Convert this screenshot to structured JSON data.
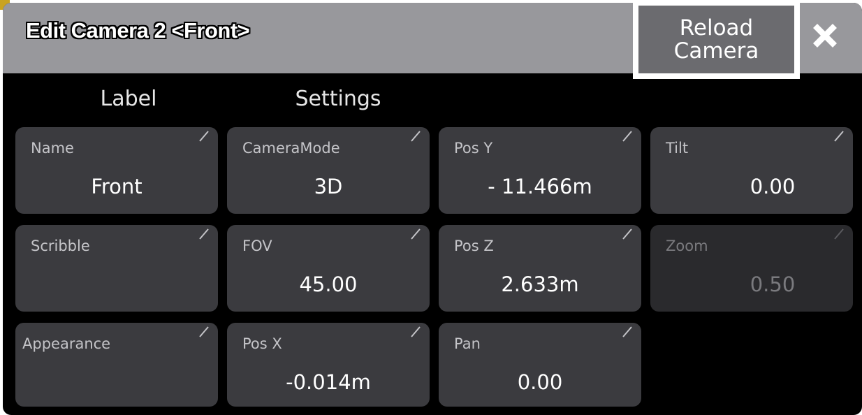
{
  "window": {
    "title": "Edit Camera 2 <Front>",
    "reload_label_line1": "Reload",
    "reload_label_line2": "Camera",
    "close_icon": "close-x-icon"
  },
  "columns": {
    "label_header": "Label",
    "settings_header": "Settings"
  },
  "fields": {
    "name": {
      "label": "Name",
      "value": "Front"
    },
    "scribble": {
      "label": "Scribble",
      "value": ""
    },
    "appearance": {
      "label": "Appearance",
      "value": ""
    },
    "cameramode": {
      "label": "CameraMode",
      "value": "3D"
    },
    "fov": {
      "label": "FOV",
      "value": "45.00"
    },
    "posx": {
      "label": "Pos X",
      "value": "-0.014m"
    },
    "posy": {
      "label": "Pos Y",
      "value": "- 11.466m"
    },
    "posz": {
      "label": "Pos Z",
      "value": "2.633m"
    },
    "pan": {
      "label": "Pan",
      "value": "0.00"
    },
    "tilt": {
      "label": "Tilt",
      "value": "0.00"
    },
    "zoom": {
      "label": "Zoom",
      "value": "0.50"
    }
  },
  "colors": {
    "titlebar": "#98989c",
    "background": "#000000",
    "cell": "#3b3b3f",
    "cell_disabled": "#2a2a2d",
    "accent": "#c9a321"
  }
}
